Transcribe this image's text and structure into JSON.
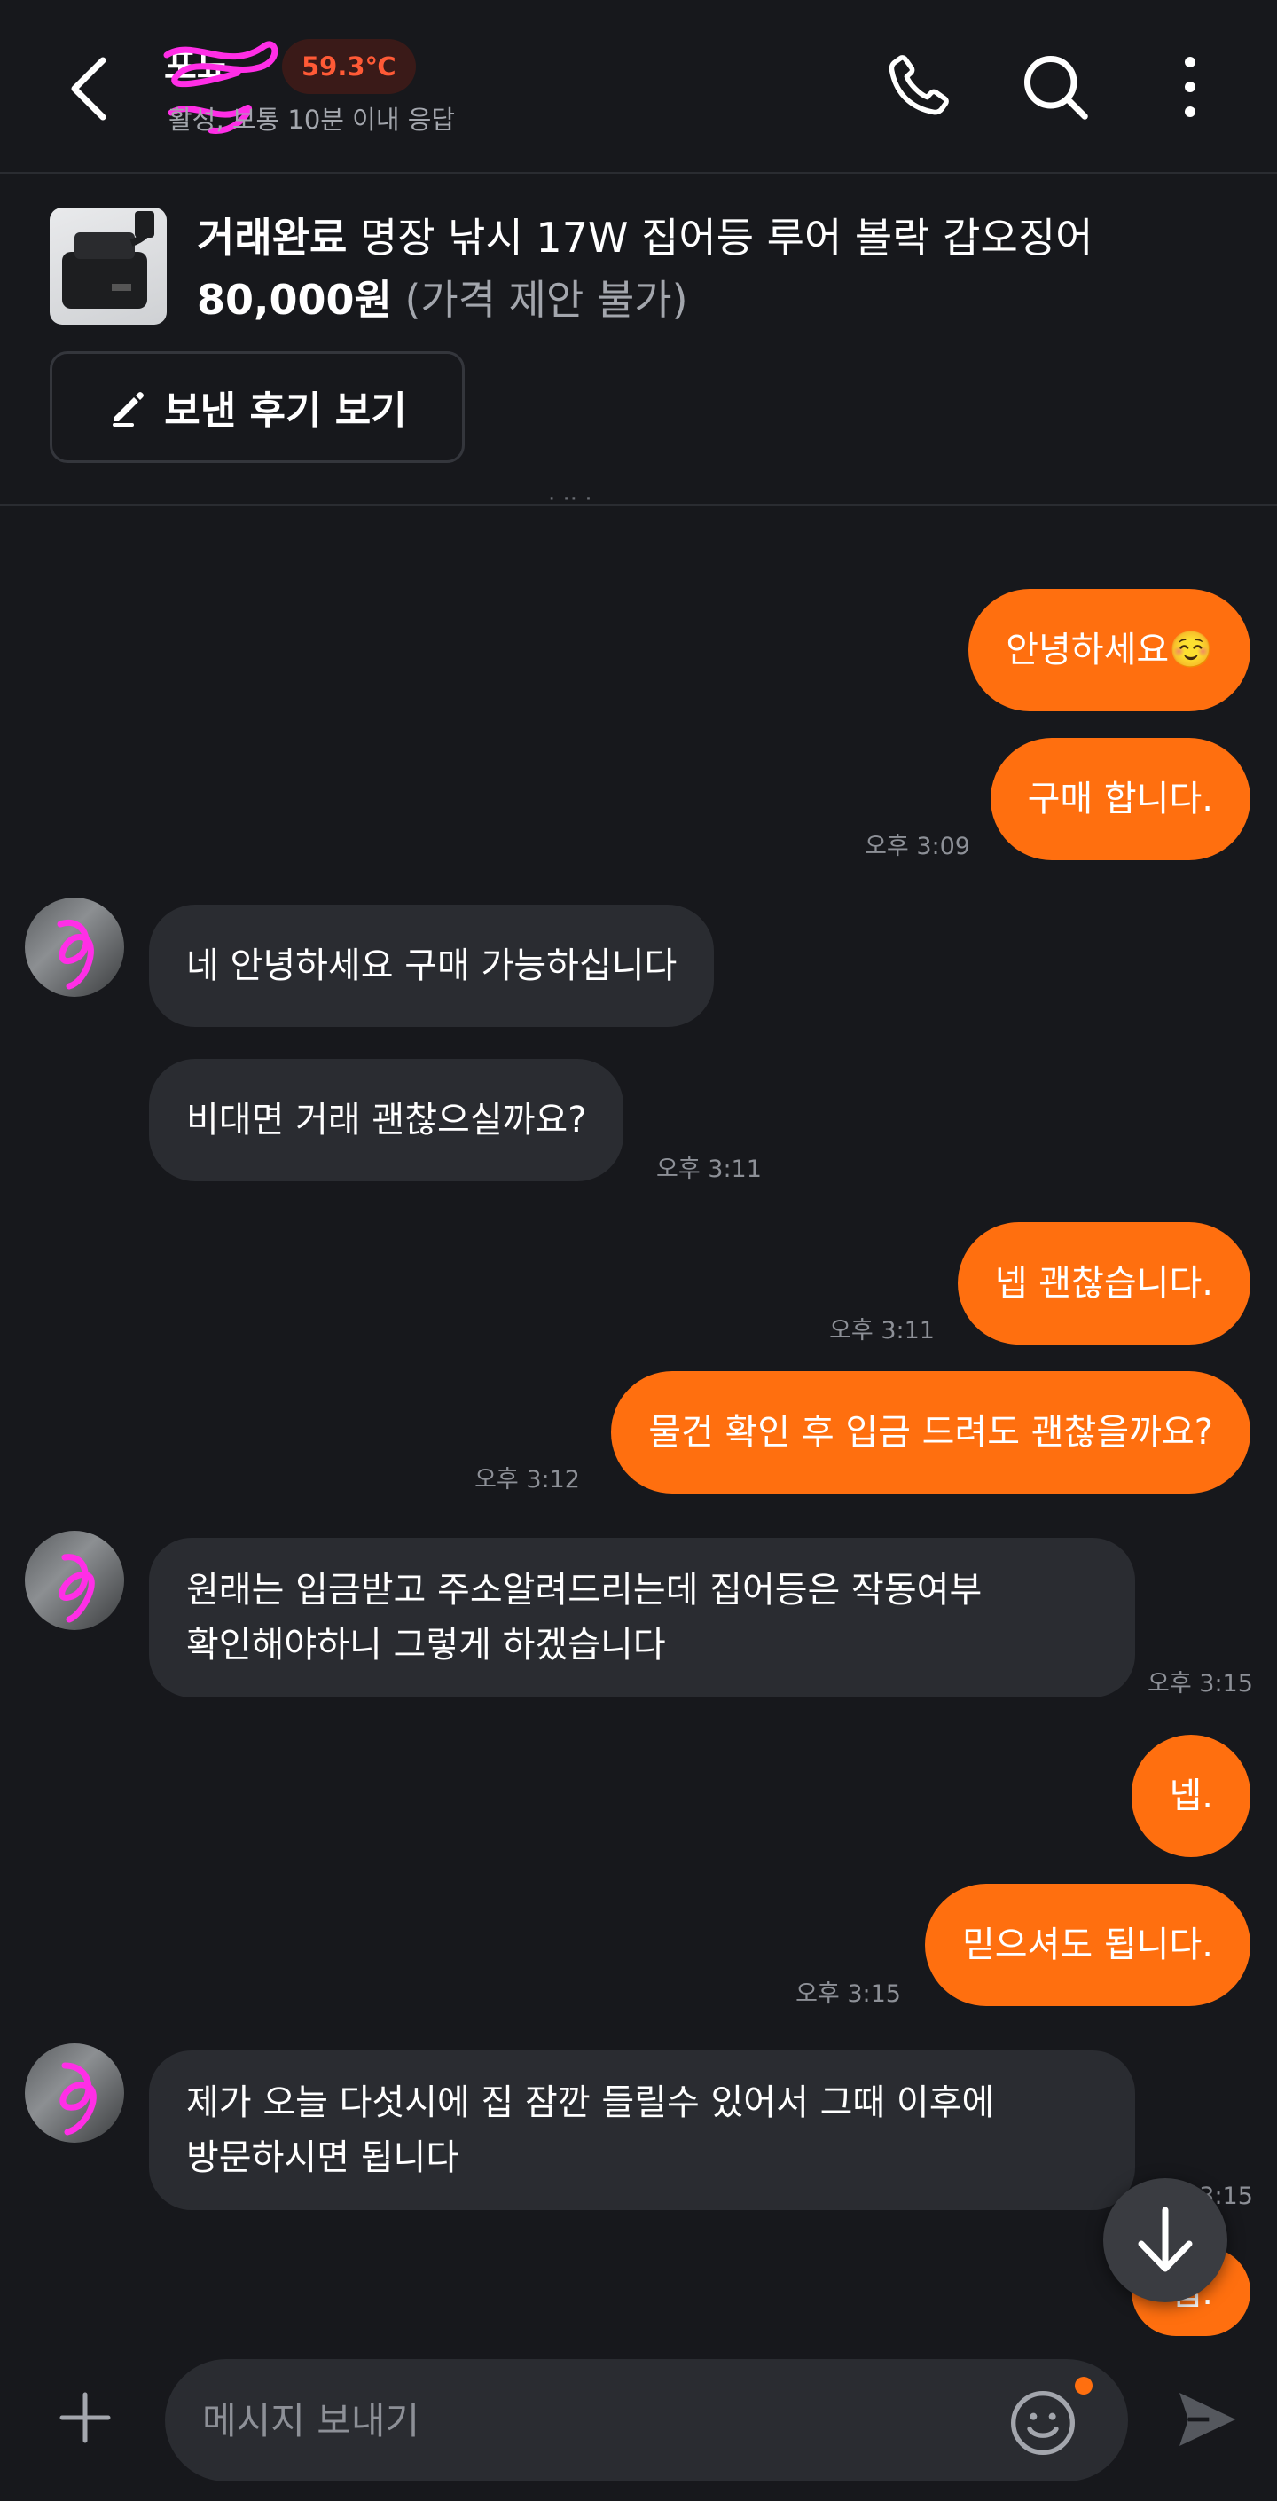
{
  "header": {
    "name": "포뇨",
    "temperature": "59.3℃",
    "status": "활성, 보통 10분 이내 응답",
    "icons": [
      "back-arrow-icon",
      "phone-icon",
      "search-icon",
      "more-vertical-icon"
    ]
  },
  "product": {
    "status": "거래완료",
    "title": "명장 낚시 17W 집어등 루어 볼락 갑오징어",
    "price": "80,000원",
    "negotiation": "(가격 제안 불가)",
    "review_button": "보낸 후기 보기",
    "review_icon": "pencil-icon"
  },
  "date_fragment": "· ·· ·",
  "messages": [
    {
      "side": "out",
      "text": "안녕하세요☺️"
    },
    {
      "side": "out",
      "text": "구매 합니다.",
      "time": "오후 3:09"
    },
    {
      "side": "in",
      "text": "네 안녕하세요 구매 가능하십니다"
    },
    {
      "side": "in",
      "text": "비대면 거래 괜찮으실까요?",
      "time": "오후 3:11"
    },
    {
      "side": "out",
      "text": "넵 괜찮습니다.",
      "time": "오후 3:11"
    },
    {
      "side": "out",
      "text": "물건 확인 후 입금 드려도 괜찮을까요?",
      "time": "오후 3:12"
    },
    {
      "side": "in",
      "lines": [
        "원래는 입금받고 주소알려드리는데 집어등은 작동여부",
        "확인해야하니 그렇게 하겠습니다"
      ],
      "time": "오후 3:15"
    },
    {
      "side": "out",
      "text": "넵."
    },
    {
      "side": "out",
      "text": "믿으셔도 됩니다.",
      "time": "오후 3:15"
    },
    {
      "side": "in",
      "lines": [
        "제가 오늘 다섯시에 집 잠깐 들릴수 있어서 그때 이후에",
        "방문하시면 됩니다"
      ],
      "time": "오후 3:15"
    },
    {
      "side": "out",
      "text": "넵."
    }
  ],
  "input": {
    "placeholder": "메시지 보내기"
  },
  "colors": {
    "accent": "#ff6f0f",
    "background": "#17181c",
    "incoming_bubble": "#2a2c31",
    "temperature": "#ff5a36"
  }
}
